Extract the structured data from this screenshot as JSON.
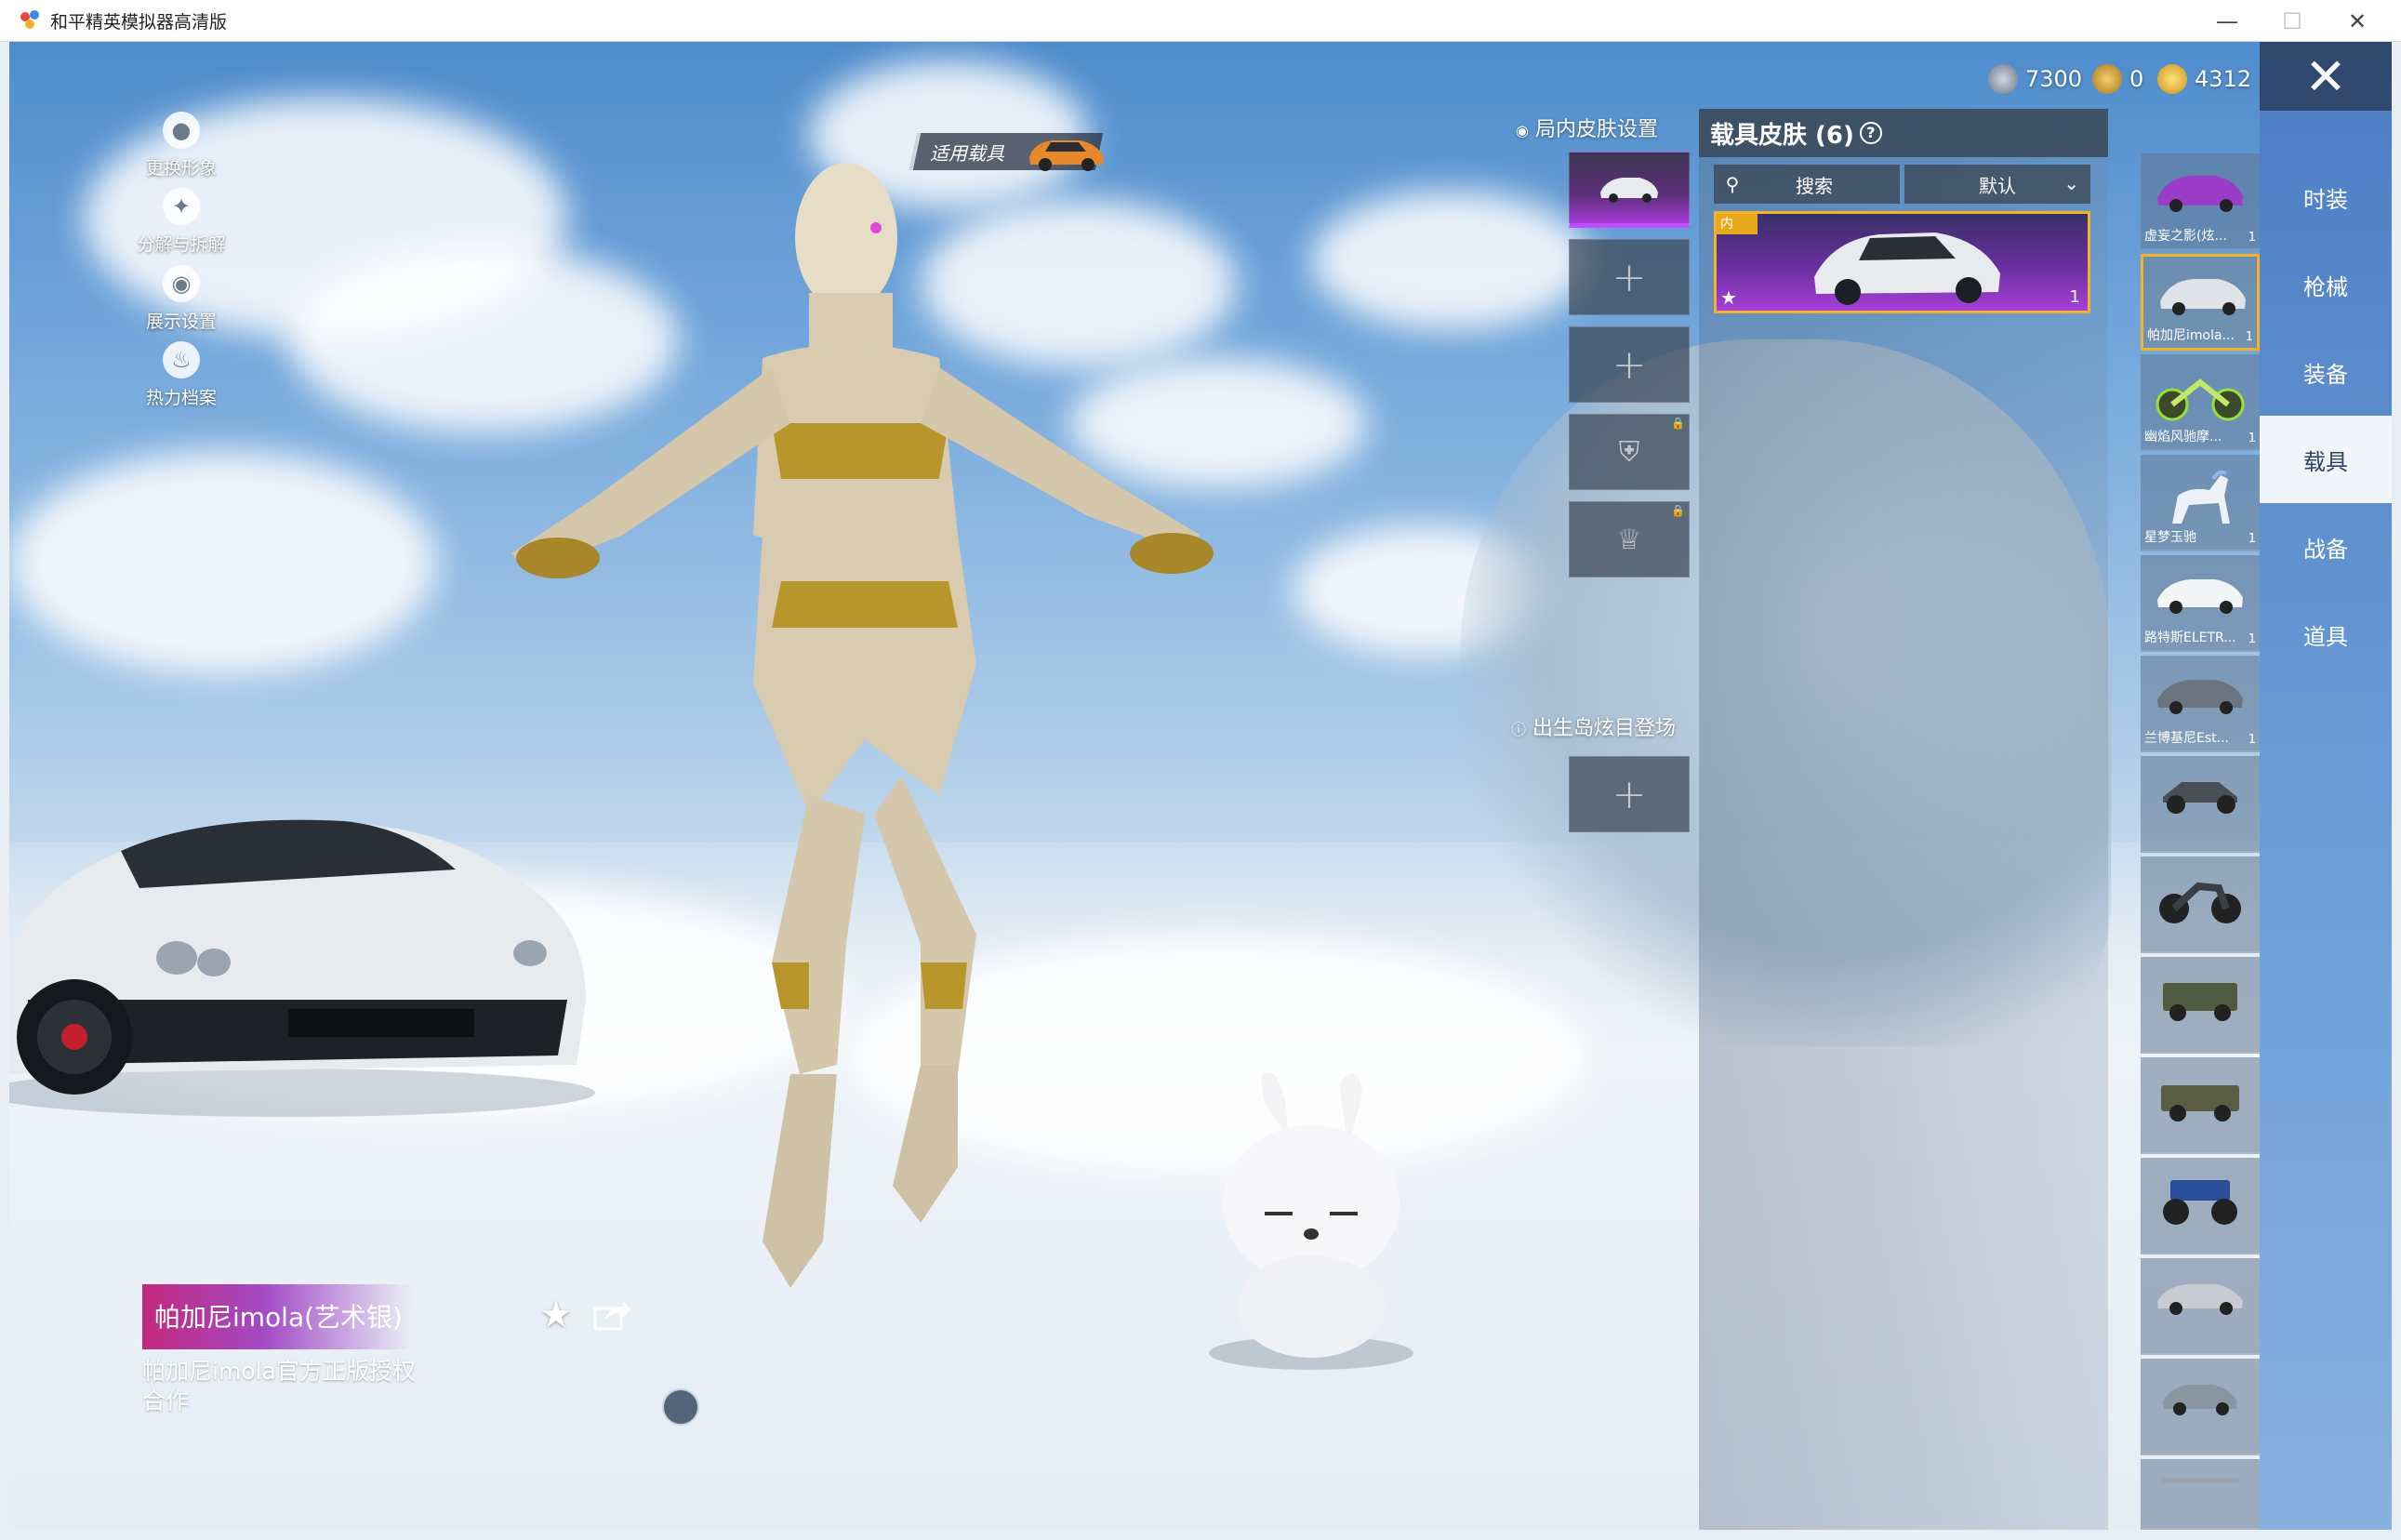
{
  "window": {
    "title": "和平精英模拟器高清版",
    "minimize_icon": "minimize-icon",
    "maximize_icon": "maximize-icon",
    "close_icon": "close-icon"
  },
  "currencies": [
    {
      "icon": "silver-coin-icon",
      "value": "7300",
      "color": "#9aa4b8"
    },
    {
      "icon": "gold-coin-icon",
      "value": "0",
      "color": "#d9a22e"
    },
    {
      "icon": "lightning-coin-icon",
      "value": "4312",
      "color": "#e7b42b"
    }
  ],
  "side_menu": [
    {
      "label": "更换形象",
      "icon": "avatar-icon"
    },
    {
      "label": "分解与拆解",
      "icon": "decompose-icon"
    },
    {
      "label": "展示设置",
      "icon": "eye-icon"
    },
    {
      "label": "热力档案",
      "icon": "flame-icon"
    }
  ],
  "vehicle_tag": {
    "label": "适用载具"
  },
  "skin_setting": {
    "title": "局内皮肤设置",
    "spawn_title": "出生岛炫目登场"
  },
  "vehicle_panel": {
    "title": "载具皮肤 (6)",
    "search_label": "搜索",
    "sort_label": "默认",
    "card_badge": "内",
    "card_count": "1"
  },
  "vehicle_list": [
    {
      "name": "虚妄之影(炫...",
      "count": "1"
    },
    {
      "name": "帕加尼imola...",
      "count": "1"
    },
    {
      "name": "幽焰风驰摩...",
      "count": "1"
    },
    {
      "name": "星梦玉驰",
      "count": "1"
    },
    {
      "name": "路特斯ELETR...",
      "count": "1"
    },
    {
      "name": "兰博基尼Est...",
      "count": "1"
    },
    {
      "name": "",
      "count": ""
    },
    {
      "name": "",
      "count": ""
    },
    {
      "name": "",
      "count": ""
    },
    {
      "name": "",
      "count": ""
    },
    {
      "name": "",
      "count": ""
    },
    {
      "name": "",
      "count": ""
    },
    {
      "name": "",
      "count": ""
    }
  ],
  "tabs": [
    {
      "label": "时装"
    },
    {
      "label": "枪械"
    },
    {
      "label": "装备"
    },
    {
      "label": "载具"
    },
    {
      "label": "战备"
    },
    {
      "label": "道具"
    }
  ],
  "selected_item": {
    "title": "帕加尼imola(艺术银)",
    "description": "帕加尼imola官方正版授权合作"
  },
  "colors": {
    "accent_purple": "#a63fd6",
    "accent_gold": "#f2b22a",
    "tab_active_bg": "#ffffff"
  }
}
